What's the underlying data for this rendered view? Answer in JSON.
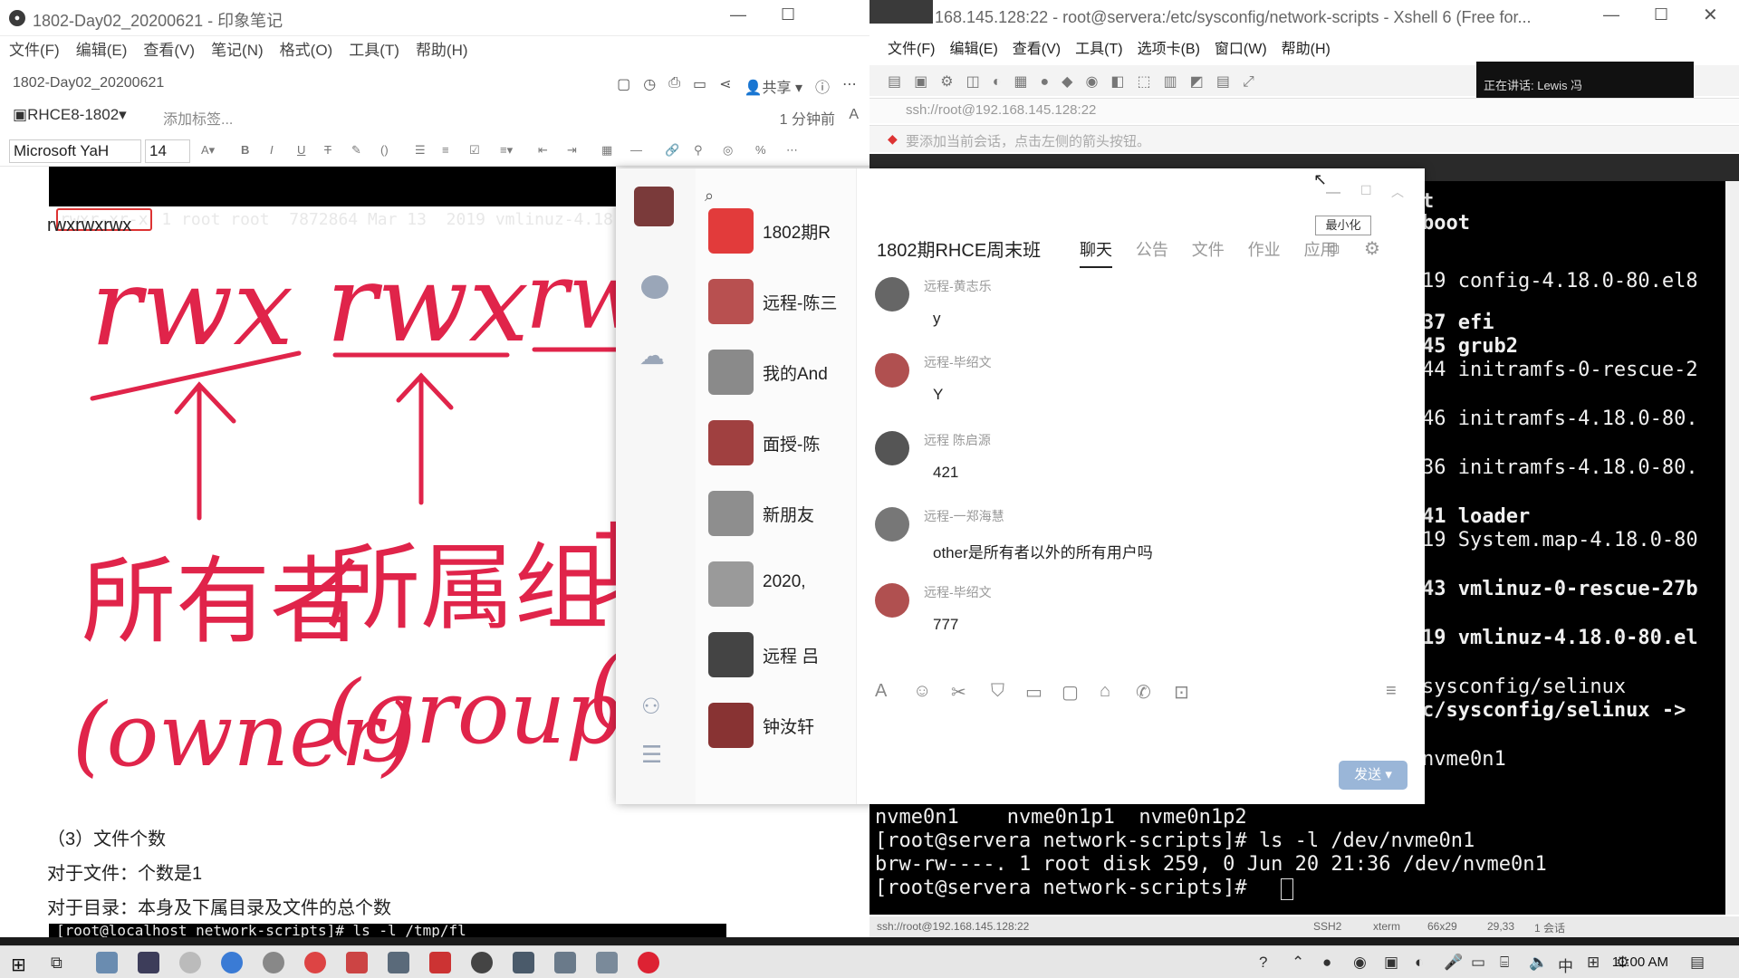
{
  "evernote": {
    "title": "1802-Day02_20200621 - 印象笔记",
    "menu": [
      "文件(F)",
      "编辑(E)",
      "查看(V)",
      "笔记(N)",
      "格式(O)",
      "工具(T)",
      "帮助(H)"
    ],
    "note_name": "1802-Day02_20200621",
    "share_label": "共享",
    "notebook_tag": "RHCE8-1802",
    "add_tag": "添加标签...",
    "updated": "1 分钟前",
    "font_name": "Microsoft YaH",
    "font_size": "14",
    "terminal_top": {
      "line1": "rwxr-xr-x",
      "line1_rest": " 1 root root  7872864 Mar 13  2019 vmlinuz-4.18"
    },
    "perm_text": "rwxrwxrwx",
    "handwriting": {
      "groups": [
        "rwx",
        "rwx",
        "rw"
      ],
      "labels": [
        "所有者",
        "所属组",
        "其"
      ],
      "english": [
        "(owner)",
        "(group)",
        "("
      ]
    },
    "section_heading": "（3）文件个数",
    "line_file": "对于文件：个数是1",
    "line_dir": "对于目录：本身及下属目录及文件的总个数",
    "terminal_bottom": "[root@localhost network-scripts]# ls -l /tmp/fl"
  },
  "xshell": {
    "title": "168.145.128:22 - root@servera:/etc/sysconfig/network-scripts - Xshell 6 (Free for...",
    "menu": [
      "文件(F)",
      "编辑(E)",
      "查看(V)",
      "工具(T)",
      "选项卡(B)",
      "窗口(W)",
      "帮助(H)"
    ],
    "address": "ssh://root@192.168.145.128:22",
    "hint": "要添加当前会话，点击左侧的箭头按钮。",
    "speaking": "正在讲话: Lewis 冯",
    "terminal_lines": [
      "t",
      "boot",
      "19 config-4.18.0-80.el8",
      "37 efi",
      "45 grub2",
      "44 initramfs-0-rescue-2",
      "46 initramfs-4.18.0-80.",
      "36 initramfs-4.18.0-80.",
      "41 loader",
      "19 System.map-4.18.0-80",
      "43 vmlinuz-0-rescue-27b",
      "19 vmlinuz-4.18.0-80.el",
      "sysconfig/selinux",
      "c/sysconfig/selinux ->",
      "nvme0n1",
      "nvme0n1    nvme0n1p1  nvme0n1p2",
      "[root@servera network-scripts]# ls -l /dev/nvme0n1",
      "brw-rw----. 1 root disk 259, 0 Jun 20 21:36 /dev/nvme0n1",
      "[root@servera network-scripts]# "
    ],
    "status": {
      "session": "ssh://root@192.168.145.128:22",
      "proto": "SSH2",
      "term": "xterm",
      "size": "66x29",
      "pos": "29,33",
      "sessions": "1 会话"
    }
  },
  "qq": {
    "search_icon": "search-icon",
    "contacts": [
      {
        "name": "1802期R",
        "color": "#e23b3b"
      },
      {
        "name": "远程-陈三",
        "color": "#b85050"
      },
      {
        "name": "我的And",
        "color": "#8a8a8a"
      },
      {
        "name": "面授-陈",
        "color": "#a04040"
      },
      {
        "name": "新朋友",
        "color": "#8e8e8e"
      },
      {
        "name": "2020,",
        "color": "#9a9a9a"
      },
      {
        "name": "远程 吕",
        "color": "#444"
      },
      {
        "name": "钟汝轩",
        "color": "#883333"
      }
    ],
    "group_name": "1802期RHCE周末班",
    "tabs": [
      "聊天",
      "公告",
      "文件",
      "作业",
      "应用"
    ],
    "tooltip": "最小化",
    "messages": [
      {
        "sender": "远程-黄志乐",
        "text": "y"
      },
      {
        "sender": "远程-毕绍文",
        "text": "Y"
      },
      {
        "sender": "远程 陈启源",
        "text": "421"
      },
      {
        "sender": "远程-一郑海慧",
        "text": "other是所有者以外的所有用户吗"
      },
      {
        "sender": "远程-毕绍文",
        "text": "777"
      }
    ],
    "send_label": "发送"
  },
  "taskbar": {
    "clock": "11:00 AM",
    "ime": "中"
  }
}
